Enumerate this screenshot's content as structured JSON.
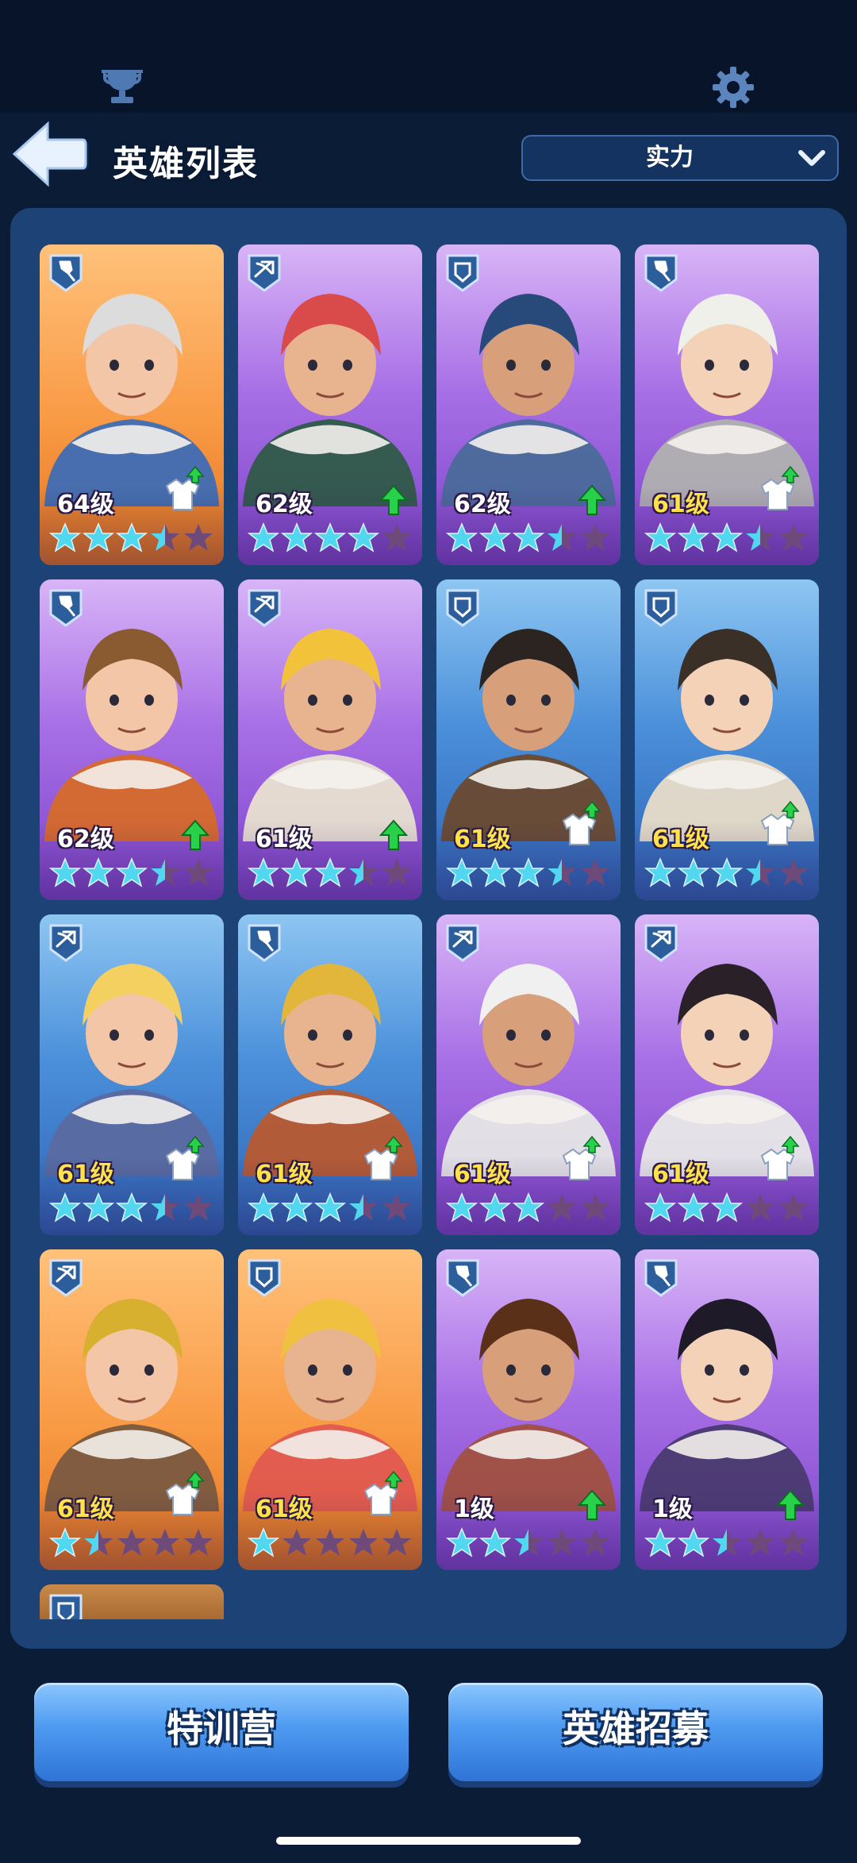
{
  "header": {
    "title": "英雄列表",
    "sort_value": "实力"
  },
  "heroes": [
    {
      "level": "64级",
      "role": "support-shovel",
      "color": "orange",
      "stars_full": 3,
      "stars_half": 1,
      "indicator": "gear-up",
      "level_gold": false
    },
    {
      "level": "62级",
      "role": "ranged-crossbow",
      "color": "purple",
      "stars_full": 4,
      "stars_half": 0,
      "indicator": "arrow-up",
      "level_gold": false
    },
    {
      "level": "62级",
      "role": "tank-shield",
      "color": "purple",
      "stars_full": 3,
      "stars_half": 1,
      "indicator": "arrow-up",
      "level_gold": false
    },
    {
      "level": "61级",
      "role": "support-shovel",
      "color": "purple",
      "stars_full": 3,
      "stars_half": 1,
      "indicator": "gear-up",
      "level_gold": true
    },
    {
      "level": "62级",
      "role": "support-shovel",
      "color": "purple",
      "stars_full": 3,
      "stars_half": 1,
      "indicator": "arrow-up",
      "level_gold": false
    },
    {
      "level": "61级",
      "role": "ranged-crossbow",
      "color": "purple",
      "stars_full": 3,
      "stars_half": 1,
      "indicator": "arrow-up",
      "level_gold": false
    },
    {
      "level": "61级",
      "role": "tank-shield",
      "color": "blue",
      "stars_full": 3,
      "stars_half": 1,
      "indicator": "gear-up",
      "level_gold": true
    },
    {
      "level": "61级",
      "role": "tank-shield",
      "color": "blue",
      "stars_full": 3,
      "stars_half": 1,
      "indicator": "gear-up",
      "level_gold": true
    },
    {
      "level": "61级",
      "role": "ranged-crossbow",
      "color": "blue",
      "stars_full": 3,
      "stars_half": 1,
      "indicator": "gear-up",
      "level_gold": true
    },
    {
      "level": "61级",
      "role": "support-shovel",
      "color": "blue",
      "stars_full": 3,
      "stars_half": 1,
      "indicator": "gear-up",
      "level_gold": true
    },
    {
      "level": "61级",
      "role": "ranged-crossbow",
      "color": "purple",
      "stars_full": 3,
      "stars_half": 0,
      "indicator": "gear-up",
      "level_gold": true
    },
    {
      "level": "61级",
      "role": "ranged-crossbow",
      "color": "purple",
      "stars_full": 3,
      "stars_half": 0,
      "indicator": "gear-up",
      "level_gold": true
    },
    {
      "level": "61级",
      "role": "ranged-crossbow",
      "color": "orange",
      "stars_full": 1,
      "stars_half": 1,
      "indicator": "gear-up",
      "level_gold": true
    },
    {
      "level": "61级",
      "role": "tank-shield",
      "color": "orange",
      "stars_full": 1,
      "stars_half": 0,
      "indicator": "gear-up",
      "level_gold": true
    },
    {
      "level": "1级",
      "role": "support-shovel",
      "color": "purple",
      "stars_full": 2,
      "stars_half": 1,
      "indicator": "arrow-up",
      "level_gold": false
    },
    {
      "level": "1级",
      "role": "support-shovel",
      "color": "purple",
      "stars_full": 2,
      "stars_half": 1,
      "indicator": "arrow-up",
      "level_gold": false
    }
  ],
  "partial_card": {
    "role": "tank-shield",
    "color": "orange"
  },
  "colors": {
    "orange": "#f99a45",
    "purple": "#a870e6",
    "blue": "#4b90da",
    "star_lit": "#52d7f0",
    "star_dim": "#6e4a7a",
    "arrow_green": "#27d24a"
  },
  "footer": {
    "training_label": "特训营",
    "recruit_label": "英雄招募"
  }
}
